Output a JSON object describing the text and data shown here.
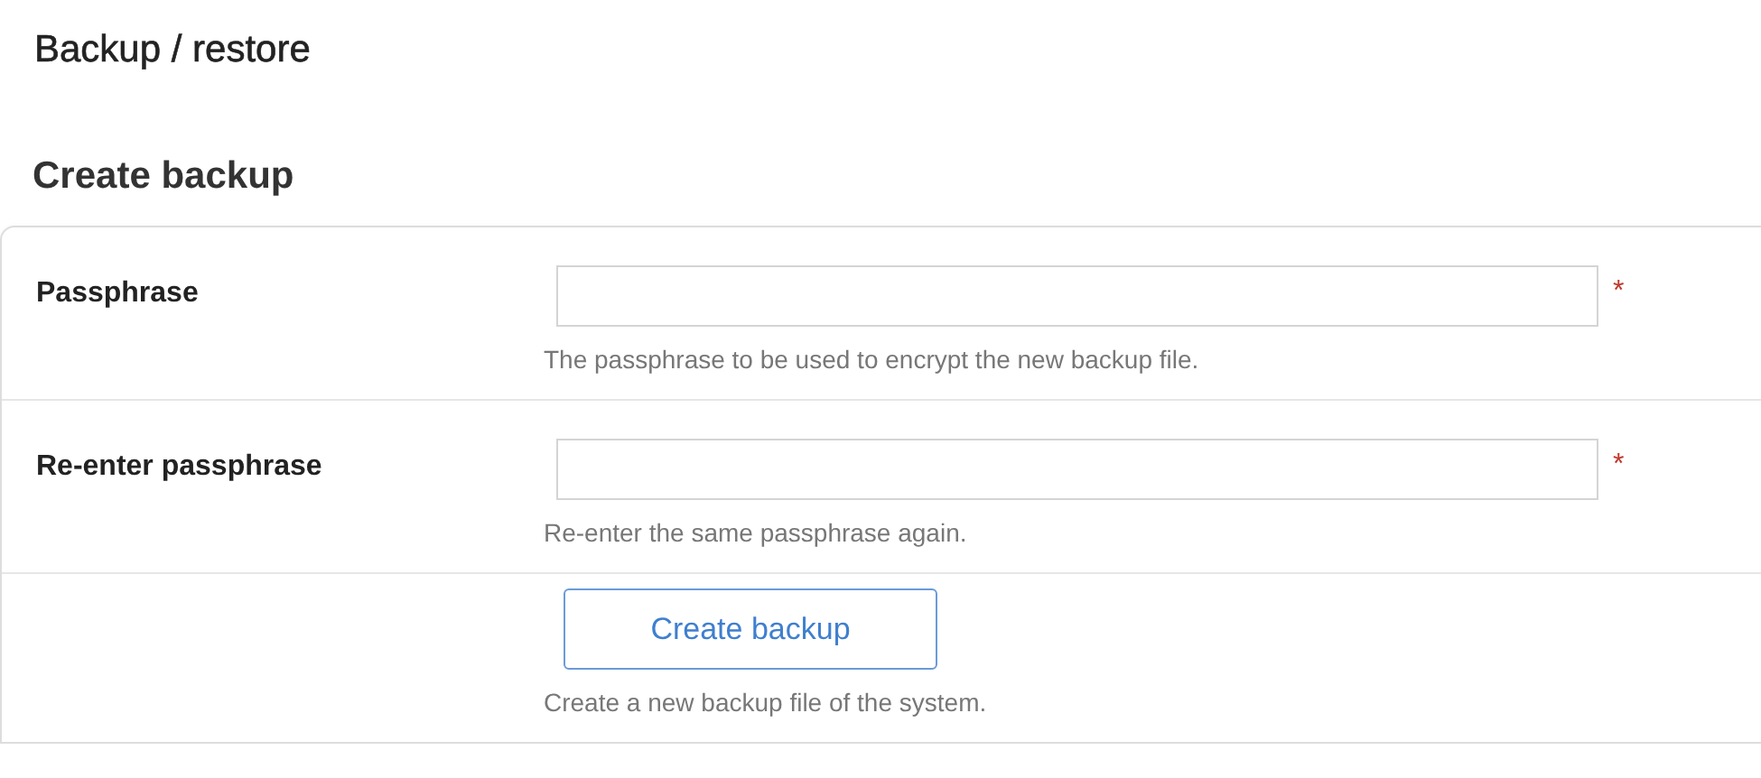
{
  "page_title": "Backup / restore",
  "section_title": "Create backup",
  "fields": [
    {
      "kind": "password",
      "label": "Passphrase",
      "required": true,
      "help": "The passphrase to be used to encrypt the new backup file."
    },
    {
      "kind": "password",
      "label": "Re-enter passphrase",
      "required": true,
      "help": "Re-enter the same passphrase again."
    },
    {
      "kind": "button",
      "label": "Create backup",
      "help": "Create a new backup file of the system."
    }
  ],
  "required_mark": "*"
}
